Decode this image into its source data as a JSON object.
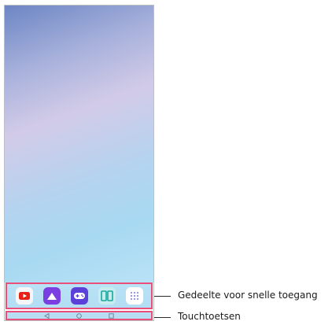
{
  "quick_access": {
    "apps": [
      {
        "icon": "youtube-icon",
        "color": "#f4f4f6"
      },
      {
        "icon": "gallery-icon",
        "color": "#7a3fe0"
      },
      {
        "icon": "game-launcher-icon",
        "color": "#5a3fd6"
      },
      {
        "icon": "dual-window-icon",
        "color": "#28b6a8"
      },
      {
        "icon": "app-drawer-icon",
        "color": "#ffffff"
      }
    ]
  },
  "touch_keys": [
    "back-key-icon",
    "home-key-icon",
    "recents-key-icon"
  ],
  "callouts": {
    "quick_access_label": "Gedeelte voor snelle toegang",
    "touch_keys_label": "Touchtoetsen"
  },
  "colors": {
    "highlight_border": "#e94f7a",
    "callout_line": "#2a2a2a"
  }
}
